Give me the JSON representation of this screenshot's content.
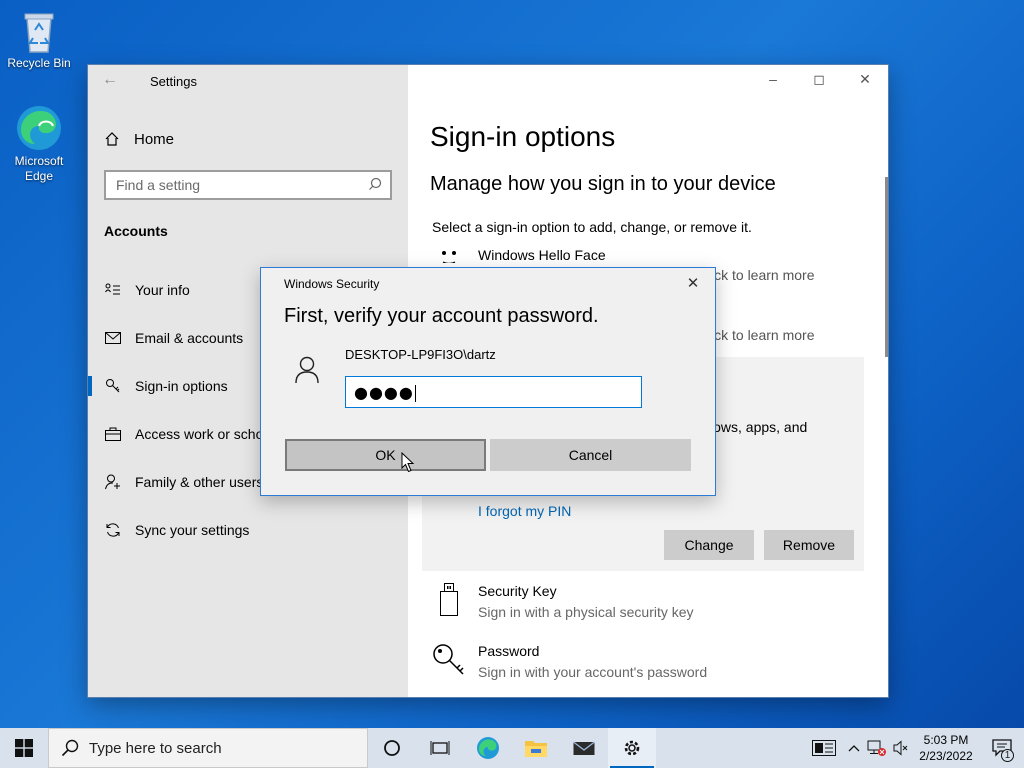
{
  "desktop": {
    "recycle_bin": "Recycle Bin",
    "edge_line1": "Microsoft",
    "edge_line2": "Edge"
  },
  "settings": {
    "window_title": "Settings",
    "home": "Home",
    "search_placeholder": "Find a setting",
    "section": "Accounts",
    "nav": [
      {
        "label": "Your info",
        "icon": "user-card-icon"
      },
      {
        "label": "Email & accounts",
        "icon": "mail-icon"
      },
      {
        "label": "Sign-in options",
        "icon": "key-icon"
      },
      {
        "label": "Access work or school",
        "icon": "briefcase-icon"
      },
      {
        "label": "Family & other users",
        "icon": "person-add-icon"
      },
      {
        "label": "Sync your settings",
        "icon": "sync-icon"
      }
    ],
    "page_title": "Sign-in options",
    "page_subtitle": "Manage how you sign in to your device",
    "page_desc": "Select a sign-in option to add, change, or remove it.",
    "hello_face": "Windows Hello Face",
    "click_learn_1": "ick to learn more",
    "click_learn_2": "ick to learn more",
    "pin_text": "lows, apps, and",
    "forgot_pin": "I forgot my PIN",
    "change_button": "Change",
    "remove_button": "Remove",
    "security_key_title": "Security Key",
    "security_key_sub": "Sign in with a physical security key",
    "password_title": "Password",
    "password_sub": "Sign in with your account's password"
  },
  "dialog": {
    "title": "Windows Security",
    "heading": "First, verify your account password.",
    "username": "DESKTOP-LP9FI3O\\dartz",
    "password_mask": "●●●●",
    "ok_label": "OK",
    "cancel_label": "Cancel"
  },
  "taskbar": {
    "search_placeholder": "Type here to search",
    "time": "5:03 PM",
    "date": "2/23/2022",
    "notification_count": "1"
  },
  "colors": {
    "accent": "#0067c0",
    "link": "#0066b4",
    "desktop": "#1a78d6"
  }
}
